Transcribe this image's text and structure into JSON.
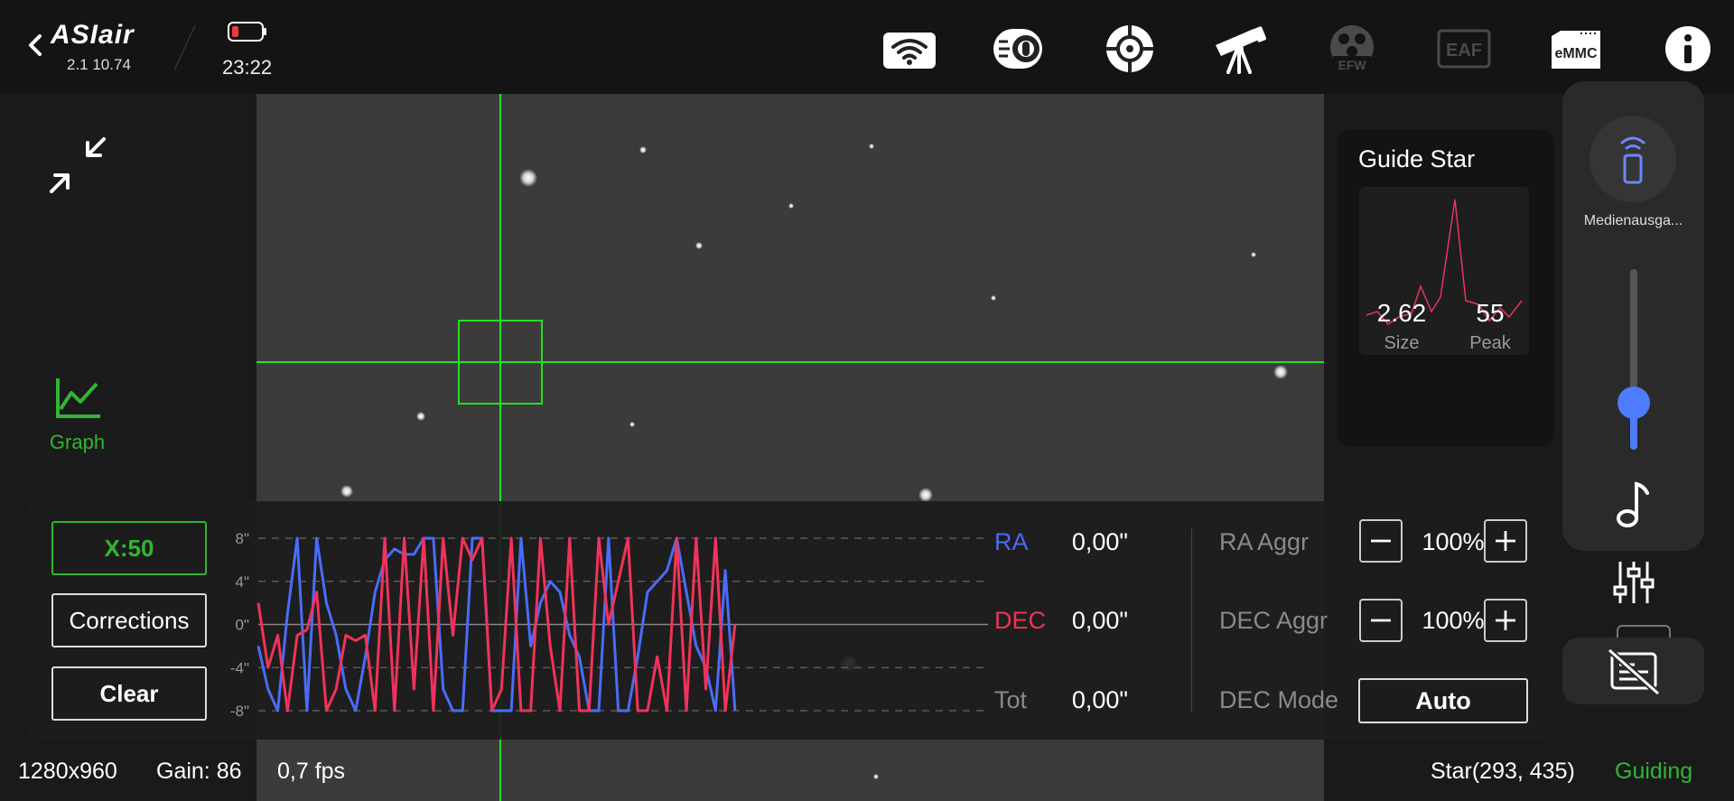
{
  "app": {
    "logo": "ASIair",
    "version": "2.1 10.74",
    "time": "23:22"
  },
  "toolbar": {
    "icons": [
      "wifi-icon",
      "camera-icon",
      "guide-scope-icon",
      "telescope-icon",
      "efw-icon",
      "eaf-icon",
      "emmc-icon",
      "info-icon"
    ],
    "efw_label": "EFW",
    "eaf_label": "EAF",
    "emmc_label": "eMMC"
  },
  "left": {
    "graph_label": "Graph"
  },
  "guide_star": {
    "title": "Guide Star",
    "size_value": "2.62",
    "size_label": "Size",
    "peak_value": "55",
    "peak_label": "Peak"
  },
  "volume": {
    "device_label": "Medienausga...",
    "level": 0.26
  },
  "graph_panel": {
    "x_scale_label": "X:50",
    "corrections_label": "Corrections",
    "clear_label": "Clear",
    "ra_label": "RA",
    "ra_value": "0,00\"",
    "dec_label": "DEC",
    "dec_value": "0,00\"",
    "tot_label": "Tot",
    "tot_value": "0,00\"",
    "ra_aggr_label": "RA Aggr",
    "ra_aggr_value": "100%",
    "dec_aggr_label": "DEC Aggr",
    "dec_aggr_value": "100%",
    "dec_mode_label": "DEC Mode",
    "dec_mode_value": "Auto"
  },
  "status": {
    "resolution": "1280x960",
    "gain": "Gain: 86",
    "fps": "0,7 fps",
    "star": "Star(293, 435)",
    "state": "Guiding"
  },
  "colors": {
    "ra": "#4a6cf7",
    "dec": "#f0335a",
    "accent": "#33b533",
    "crosshair": "#22e022"
  },
  "chart_data": {
    "type": "line",
    "yticks": [
      "8\"",
      "4\"",
      "0\"",
      "-4\"",
      "-8\""
    ],
    "ylim": [
      -8,
      8
    ],
    "x": [
      1,
      2,
      3,
      4,
      5,
      6,
      7,
      8,
      9,
      10,
      11,
      12,
      13,
      14,
      15,
      16,
      17,
      18,
      19,
      20,
      21,
      22,
      23,
      24,
      25,
      26,
      27,
      28,
      29,
      30,
      31,
      32,
      33,
      34,
      35,
      36,
      37,
      38,
      39,
      40,
      41,
      42,
      43,
      44,
      45,
      46,
      47,
      48,
      49,
      50
    ],
    "series": [
      {
        "name": "RA",
        "values": [
          -2,
          -6,
          -8,
          1,
          8,
          -8,
          8,
          2,
          -1,
          -6,
          -8,
          -3,
          3,
          6,
          7,
          6.5,
          6.5,
          8,
          8,
          -6,
          -8,
          -8,
          8,
          8,
          -8,
          -8,
          -8,
          8,
          -2,
          2,
          4,
          3,
          -1,
          -3,
          -8,
          -8,
          8,
          -8,
          -8,
          -3,
          3,
          4,
          5,
          8,
          3,
          -2,
          -4,
          -8,
          5,
          -8
        ]
      },
      {
        "name": "DEC",
        "values": [
          2,
          -4,
          -1,
          -8,
          -1,
          -0.5,
          3,
          -8,
          -6,
          -1,
          -1.5,
          -1,
          -8,
          8,
          -8,
          8,
          -6,
          8,
          -8,
          8,
          -1,
          8,
          6,
          8,
          -8,
          -6,
          8,
          -8,
          -8,
          8,
          -2,
          -8,
          8,
          -8,
          -8,
          8,
          0,
          4,
          8,
          -8,
          -8,
          -3,
          -8,
          8,
          -8,
          8,
          -6,
          8,
          -8,
          0
        ]
      }
    ]
  }
}
